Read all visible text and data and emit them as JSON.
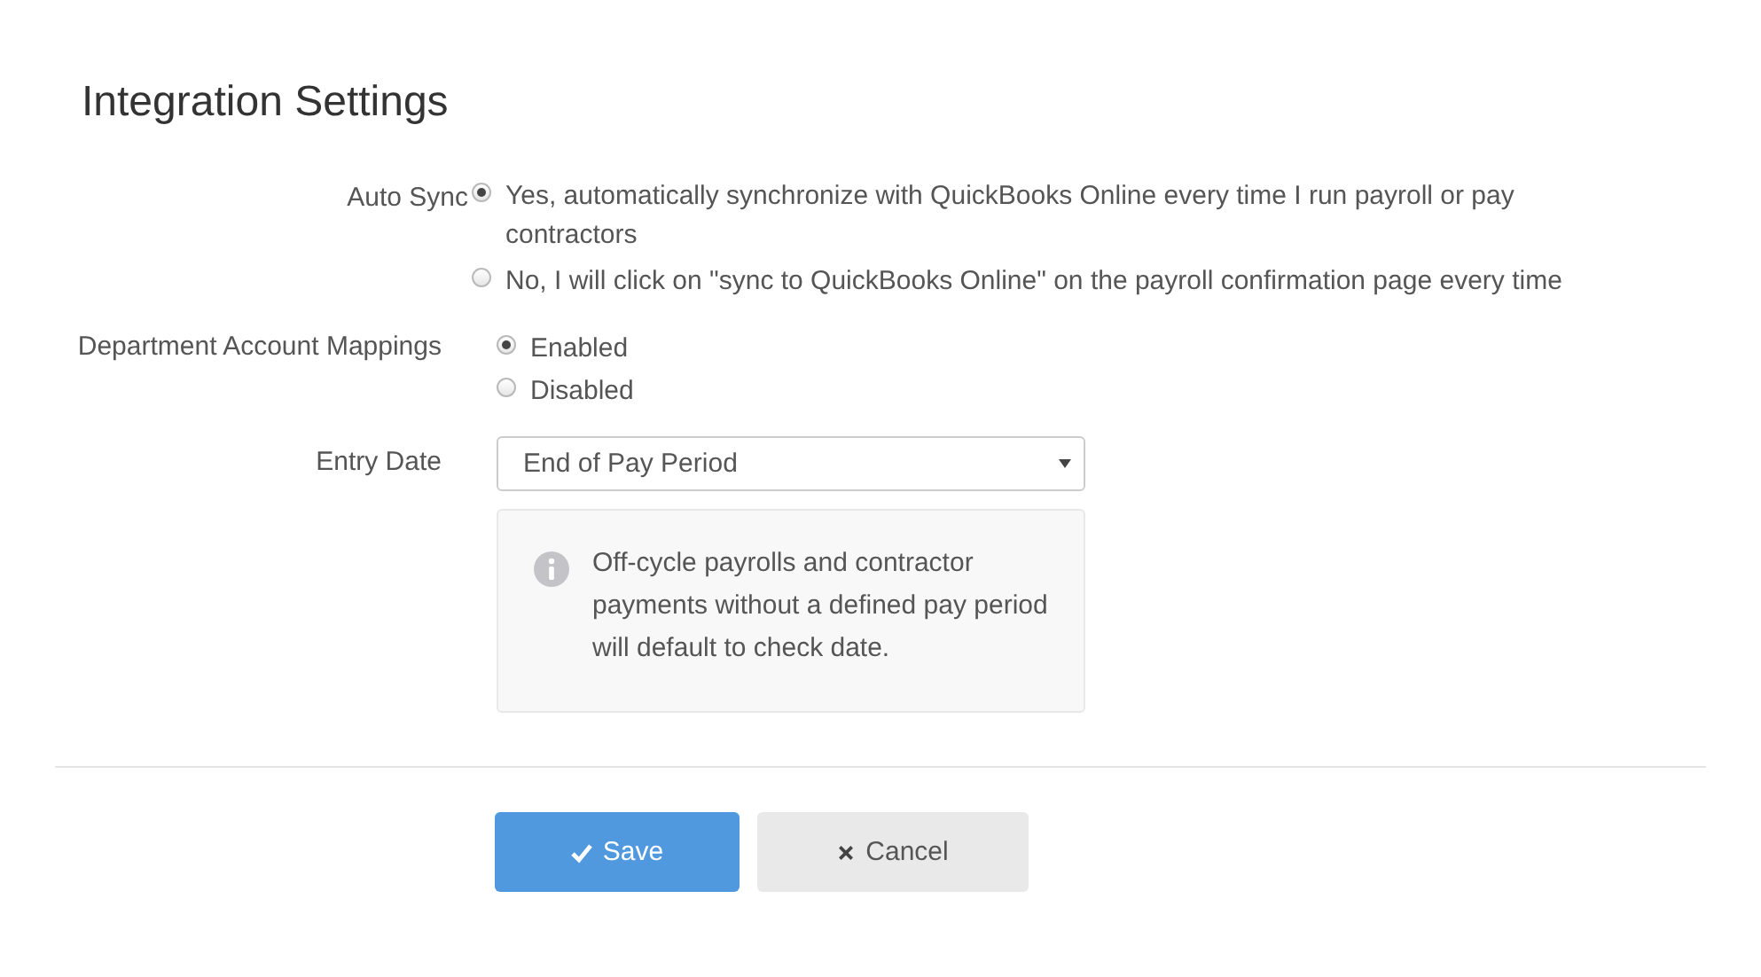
{
  "title": "Integration Settings",
  "fields": [
    {
      "kind": "radio",
      "label": "Auto Sync",
      "options": [
        {
          "label": "Yes, automatically synchronize with QuickBooks Online every time I run payroll or pay contractors",
          "selected": true
        },
        {
          "label": "No, I will click on \"sync to QuickBooks Online\" on the payroll confirmation page every time",
          "selected": false
        }
      ]
    },
    {
      "kind": "radio",
      "label": "Department Account Mappings",
      "options": [
        {
          "label": "Enabled",
          "selected": true
        },
        {
          "label": "Disabled",
          "selected": false
        }
      ]
    },
    {
      "kind": "select",
      "label": "Entry Date",
      "value": "End of Pay Period",
      "note": "Off-cycle payrolls and contractor payments without a defined pay period will default to check date."
    }
  ],
  "buttons": [
    {
      "kind": "primary",
      "label": "Save"
    },
    {
      "kind": "secondary",
      "label": "Cancel"
    }
  ]
}
